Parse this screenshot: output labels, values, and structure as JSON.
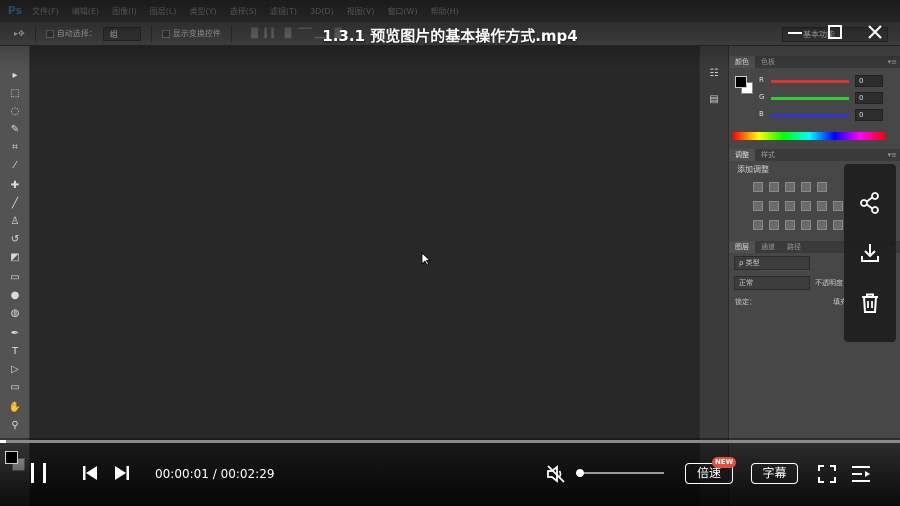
{
  "video": {
    "title": "1.3.1 预览图片的基本操作方式.mp4",
    "time": "00:00:01 / 00:02:29",
    "progress_fraction": 0.0067,
    "volume_fraction": 0.0,
    "muted": true,
    "speed_label": "倍速",
    "speed_badge": "NEW",
    "subtitle_label": "字幕",
    "accent_color": "#e74c3c"
  },
  "window_controls": {
    "minimize": "minimize-icon",
    "maximize": "maximize-icon",
    "close": "close-icon"
  },
  "side_actions": [
    "share-icon",
    "download-icon",
    "delete-icon"
  ],
  "photoshop": {
    "logo": "Ps",
    "menus": [
      "文件(F)",
      "编辑(E)",
      "图像(I)",
      "图层(L)",
      "类型(Y)",
      "选择(S)",
      "滤镜(T)",
      "3D(D)",
      "视图(V)",
      "窗口(W)",
      "帮助(H)"
    ],
    "options": {
      "auto_select_label": "自动选择：",
      "auto_select_value": "组",
      "show_transform_label": "显示变换控件"
    },
    "workspace_value": "基本功能",
    "color_panel": {
      "tabs": [
        "颜色",
        "色板"
      ],
      "channels": [
        {
          "label": "R",
          "value": "0",
          "color": "#d33"
        },
        {
          "label": "G",
          "value": "0",
          "color": "#3c3"
        },
        {
          "label": "B",
          "value": "0",
          "color": "#33d"
        }
      ]
    },
    "adjust_panel": {
      "tabs": [
        "调整",
        "样式"
      ],
      "heading": "添加调整"
    },
    "layers_panel": {
      "tabs": [
        "图层",
        "通道",
        "路径"
      ],
      "kind_label": "ρ 类型",
      "blend_mode": "正常",
      "opacity_label": "不透明度",
      "lock_label": "锁定：",
      "fill_label": "填充"
    }
  }
}
